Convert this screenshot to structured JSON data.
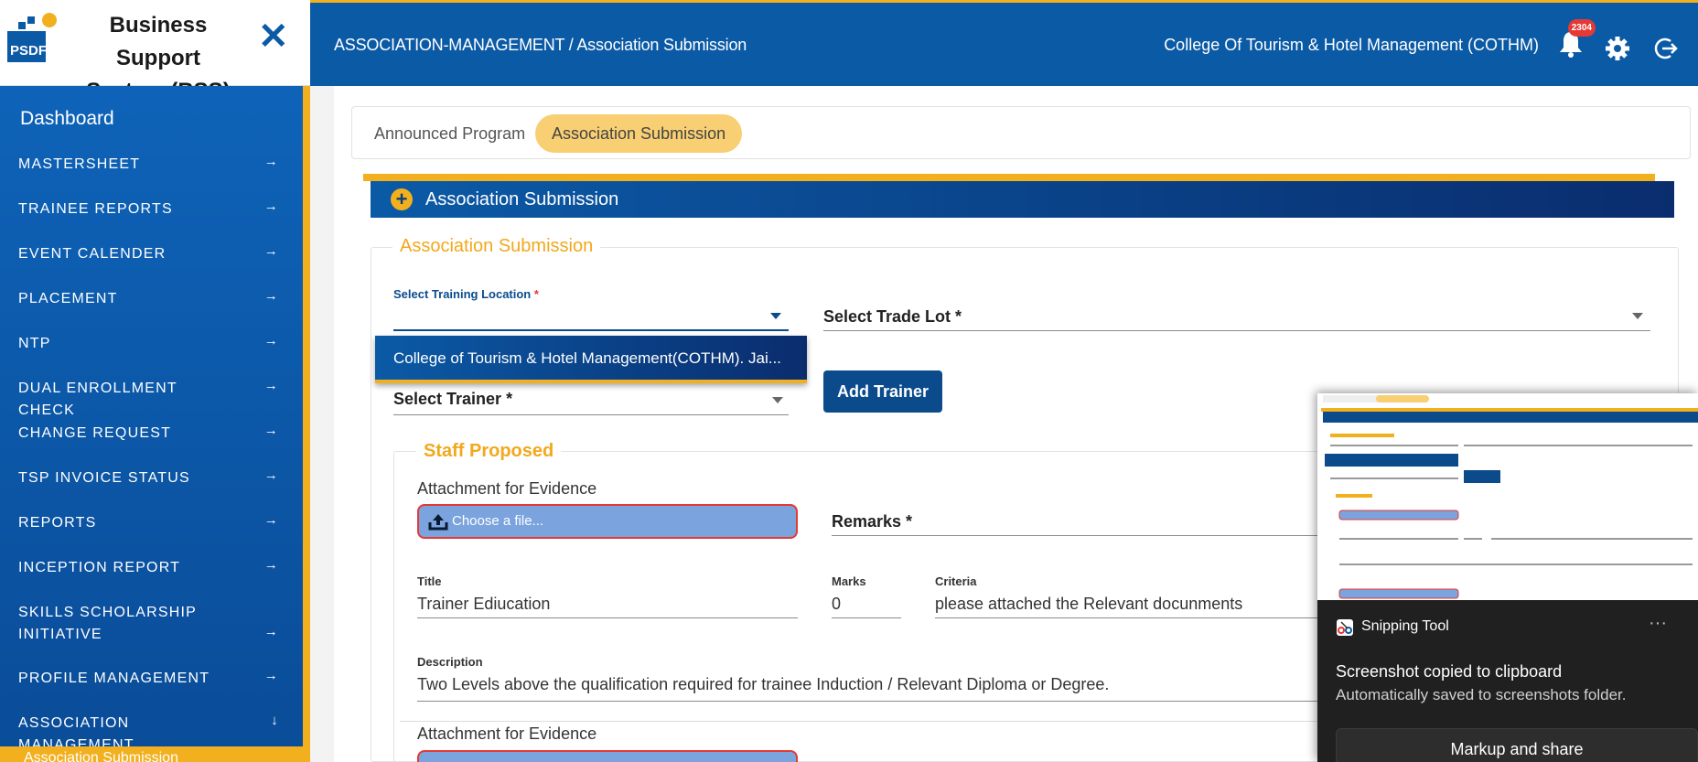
{
  "app": {
    "logo_text": "PSDF",
    "title_line1": "Business Support",
    "title_line2": "System (BSS)",
    "close_symbol": "✕"
  },
  "header": {
    "breadcrumb": "ASSOCIATION-MANAGEMENT / Association Submission",
    "tsp_name": "College Of Tourism & Hotel Management (COTHM)",
    "notification_count": "2304",
    "accent": "#0b5aa6",
    "highlight": "#f2b01e"
  },
  "sidebar": {
    "title": "Dashboard",
    "items": [
      {
        "label": "MASTERSHEET",
        "arrow": "→"
      },
      {
        "label": "TRAINEE REPORTS",
        "arrow": "→"
      },
      {
        "label": "EVENT CALENDER",
        "arrow": "→"
      },
      {
        "label": "PLACEMENT",
        "arrow": "→"
      },
      {
        "label": "NTP",
        "arrow": "→"
      },
      {
        "label": "DUAL ENROLLMENT CHECK",
        "arrow": "→"
      },
      {
        "label": "CHANGE REQUEST",
        "arrow": "→"
      },
      {
        "label": "TSP INVOICE STATUS",
        "arrow": "→"
      },
      {
        "label": "REPORTS",
        "arrow": "→"
      },
      {
        "label": "INCEPTION REPORT",
        "arrow": "→"
      },
      {
        "label": "SKILLS SCHOLARSHIP INITIATIVE",
        "arrow": "→"
      },
      {
        "label": "PROFILE MANAGEMENT",
        "arrow": "→"
      },
      {
        "label": "ASSOCIATION MANAGEMENT",
        "arrow": "↓"
      }
    ],
    "active_sub": "Association Submission"
  },
  "tabs": [
    {
      "label": "Announced Program",
      "active": false
    },
    {
      "label": "Association Submission",
      "active": true
    }
  ],
  "section": {
    "header_title": "Association Submission",
    "legend": "Association Submission",
    "training_location_label": "Select Training Location",
    "required_mark": "*",
    "trade_lot_label": "Select Trade Lot *",
    "trainer_label": "Select Trainer *",
    "dropdown_option": "College of Tourism & Hotel Management(COTHM). Jai...",
    "add_trainer_button": "Add Trainer"
  },
  "staff": {
    "legend": "Staff Proposed",
    "attachment_label": "Attachment for Evidence",
    "file_placeholder": "Choose a file...",
    "remarks_label": "Remarks *",
    "title_label": "Title",
    "title_value": "Trainer Ediucation",
    "marks_label": "Marks",
    "marks_value": "0",
    "criteria_label": "Criteria",
    "criteria_value": "please attached the Relevant docunments",
    "description_label": "Description",
    "description_value": "Two Levels above the qualification required for trainee Induction / Relevant Diploma or Degree.",
    "attachment_label_2": "Attachment for Evidence"
  },
  "snipping_tool": {
    "app_name": "Snipping Tool",
    "menu": "···",
    "message": "Screenshot copied to clipboard",
    "sub_message": "Automatically saved to screenshots folder.",
    "button": "Markup and share"
  }
}
